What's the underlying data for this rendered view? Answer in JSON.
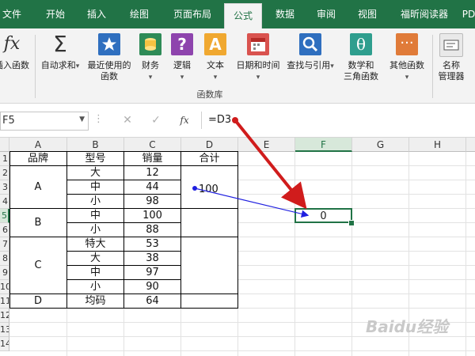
{
  "ribbon_tabs": [
    "文件",
    "开始",
    "插入",
    "绘图",
    "页面布局",
    "公式",
    "数据",
    "审阅",
    "视图",
    "福昕阅读器",
    "PD"
  ],
  "active_tab": "公式",
  "ribbon": {
    "insert_function": "插入函数",
    "autosum": "自动求和",
    "recently_used": "最近使用的\n函数",
    "financial": "财务",
    "logical": "逻辑",
    "text": "文本",
    "date_time": "日期和时间",
    "lookup_reference": "查找与引用",
    "math_trig": "数学和\n三角函数",
    "more_functions": "其他函数",
    "name_manager": "名称\n管理器",
    "group_label": "函数库",
    "fx_glyph": "fx",
    "sigma_glyph": "Σ"
  },
  "formula_bar": {
    "name_box": "F5",
    "cancel": "✕",
    "enter": "✓",
    "fx": "fx",
    "formula": "=D3"
  },
  "columns": [
    "A",
    "B",
    "C",
    "D",
    "E",
    "F",
    "G",
    "H"
  ],
  "selected_column": "F",
  "rows": [
    "1",
    "2",
    "3",
    "4",
    "5",
    "6",
    "7",
    "8",
    "9",
    "10",
    "11",
    "12",
    "13",
    "14"
  ],
  "selected_row": "5",
  "table": {
    "headers": [
      "品牌",
      "型号",
      "销量",
      "合计"
    ],
    "brands": [
      "A",
      "B",
      "C",
      "D"
    ],
    "models": [
      "大",
      "中",
      "小",
      "中",
      "小",
      "特大",
      "大",
      "中",
      "小",
      "均码"
    ],
    "sales": [
      "12",
      "44",
      "98",
      "100",
      "88",
      "53",
      "38",
      "97",
      "90",
      "64"
    ],
    "d_value": "100"
  },
  "selected_cell": {
    "ref": "F5",
    "value": "0"
  },
  "colors": {
    "ribbon_green": "#217346",
    "arrow_red": "#d01c1c",
    "trace_blue": "#1f1fe0"
  },
  "watermark": "Baidu经验"
}
